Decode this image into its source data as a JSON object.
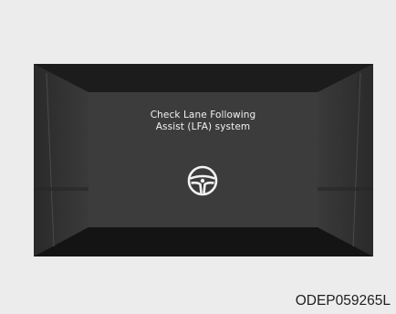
{
  "cluster": {
    "message_line1": "Check Lane Following",
    "message_line2": "Assist (LFA) system",
    "icon": "steering-wheel-icon"
  },
  "figure": {
    "code": "ODEP059265L"
  },
  "colors": {
    "page_background": "#ececec",
    "bezel": "#181818",
    "screen": "#3c3c3c",
    "text": "#f2f2f2"
  }
}
